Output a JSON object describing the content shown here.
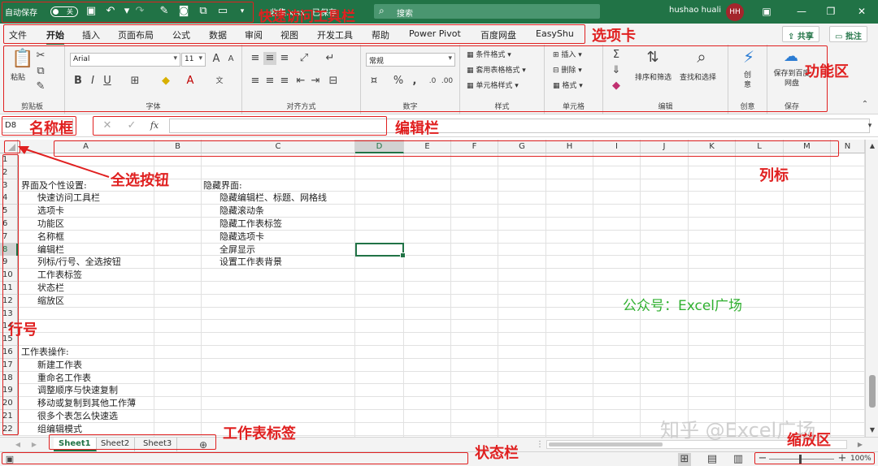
{
  "title_bar": {
    "autosave_label": "自动保存",
    "autosave_state": "关",
    "filename": "收集.xlsx",
    "saved_state": "已保存",
    "search_placeholder": "搜索",
    "user_name": "hushao huali",
    "user_initials": "HH"
  },
  "tabs": [
    "文件",
    "开始",
    "插入",
    "页面布局",
    "公式",
    "数据",
    "审阅",
    "视图",
    "开发工具",
    "帮助",
    "Power Pivot",
    "百度网盘",
    "EasyShu"
  ],
  "active_tab": "开始",
  "share_label": "共享",
  "comments_label": "批注",
  "ribbon": {
    "clipboard": {
      "label": "剪贴板",
      "paste": "粘贴"
    },
    "font": {
      "label": "字体",
      "name": "Arial",
      "size": "11",
      "bold": "B",
      "italic": "I",
      "underline": "U"
    },
    "alignment": {
      "label": "对齐方式"
    },
    "number": {
      "label": "数字",
      "format": "常规"
    },
    "styles": {
      "label": "样式",
      "cond": "条件格式",
      "table": "套用表格格式",
      "cell": "单元格样式"
    },
    "cells": {
      "label": "单元格",
      "insert": "插入",
      "delete": "删除",
      "format": "格式"
    },
    "editing": {
      "label": "编辑",
      "sort": "排序和筛选",
      "find": "查找和选择"
    },
    "creativity": {
      "label": "创意",
      "btn": "创意"
    },
    "save": {
      "label": "保存",
      "btn": "保存到百度网盘"
    }
  },
  "formula_bar": {
    "name_box": "D8",
    "fx": "fx",
    "content": ""
  },
  "columns": [
    "A",
    "B",
    "C",
    "D",
    "E",
    "F",
    "G",
    "H",
    "I",
    "J",
    "K",
    "L",
    "M",
    "N"
  ],
  "selected_column": "D",
  "rows": [
    "1",
    "2",
    "3",
    "4",
    "5",
    "6",
    "7",
    "8",
    "9",
    "10",
    "11",
    "12",
    "13",
    "14",
    "15",
    "16",
    "17",
    "18",
    "19",
    "20",
    "21",
    "22"
  ],
  "selected_row": "8",
  "cells": {
    "A3": "界面及个性设置:",
    "A4": "快速访问工具栏",
    "A5": "选项卡",
    "A6": "功能区",
    "A7": "名称框",
    "A8": "编辑栏",
    "A9": "列标/行号、全选按钮",
    "A10": "工作表标签",
    "A11": "状态栏",
    "A12": "缩放区",
    "A16": "工作表操作:",
    "A17": "新建工作表",
    "A18": "重命名工作表",
    "A19": "调整顺序与快速复制",
    "A20": "移动或复制到其他工作薄",
    "A21": "很多个表怎么快速选",
    "A22": "组编辑模式",
    "C3": "隐藏界面:",
    "C4": "隐藏编辑栏、标题、网格线",
    "C5": "隐藏滚动条",
    "C6": "隐藏工作表标签",
    "C7": "隐藏选项卡",
    "C8": "全屏显示",
    "C9": "设置工作表背景"
  },
  "sheets": [
    "Sheet1",
    "Sheet2",
    "Sheet3"
  ],
  "active_sheet": "Sheet1",
  "zoom": "100%",
  "annotations": {
    "quick_access": "快速访问工具栏",
    "tabs": "选项卡",
    "ribbon": "功能区",
    "name_box": "名称框",
    "formula_bar": "编辑栏",
    "select_all": "全选按钮",
    "col_header": "列标",
    "row_header": "行号",
    "sheet_tabs": "工作表标签",
    "status_bar": "状态栏",
    "zoom": "缩放区"
  },
  "wechat_note": "公众号：Excel广场",
  "watermark": "知乎 @Excel广场",
  "colors": {
    "excel_green": "#217346",
    "annotation_red": "#e02020",
    "note_green": "#30b030"
  }
}
